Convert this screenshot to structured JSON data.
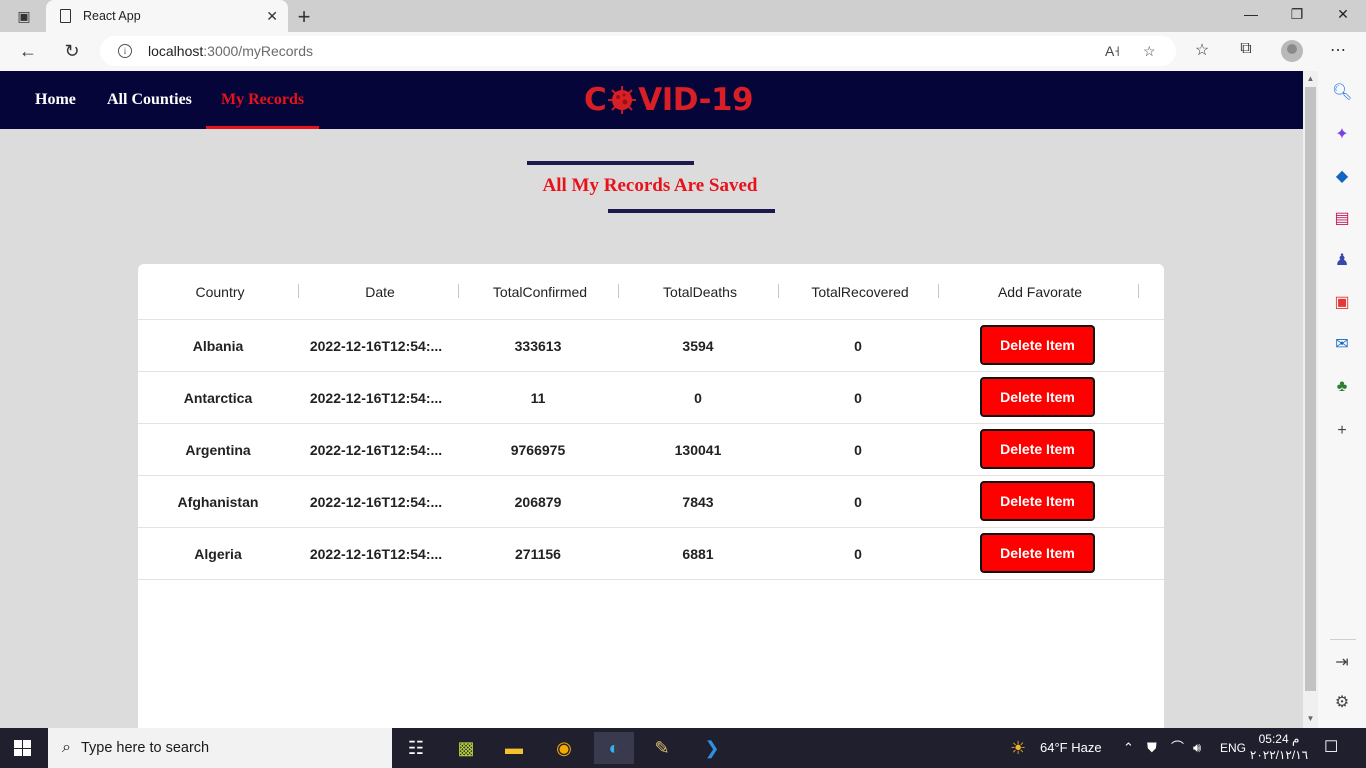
{
  "browser": {
    "tab_title": "React App",
    "url_host": "localhost",
    "url_rest": ":3000/myRecords"
  },
  "nav": {
    "links": [
      "Home",
      "All Counties",
      "My Records"
    ],
    "active": "My Records",
    "logo_left": "C",
    "logo_right": "VID-19"
  },
  "page": {
    "title": "All My Records Are Saved"
  },
  "table": {
    "columns": [
      "Country",
      "Date",
      "TotalConfirmed",
      "TotalDeaths",
      "TotalRecovered",
      "Add Favorate"
    ],
    "rows": [
      {
        "country": "Albania",
        "date": "2022-12-16T12:54:...",
        "confirmed": "333613",
        "deaths": "3594",
        "recovered": "0",
        "action": "Delete Item"
      },
      {
        "country": "Antarctica",
        "date": "2022-12-16T12:54:...",
        "confirmed": "11",
        "deaths": "0",
        "recovered": "0",
        "action": "Delete Item"
      },
      {
        "country": "Argentina",
        "date": "2022-12-16T12:54:...",
        "confirmed": "9766975",
        "deaths": "130041",
        "recovered": "0",
        "action": "Delete Item"
      },
      {
        "country": "Afghanistan",
        "date": "2022-12-16T12:54:...",
        "confirmed": "206879",
        "deaths": "7843",
        "recovered": "0",
        "action": "Delete Item"
      },
      {
        "country": "Algeria",
        "date": "2022-12-16T12:54:...",
        "confirmed": "271156",
        "deaths": "6881",
        "recovered": "0",
        "action": "Delete Item"
      }
    ]
  },
  "taskbar": {
    "search_placeholder": "Type here to search",
    "weather": "64°F  Haze",
    "language": "ENG",
    "time": "05:24 م",
    "date": "٢٠٢٢/١٢/١٦"
  },
  "colors": {
    "navbar": "#05053a",
    "accent_red": "#e8121b",
    "button_red": "#ff0000",
    "page_bg": "#dcdcdc"
  }
}
